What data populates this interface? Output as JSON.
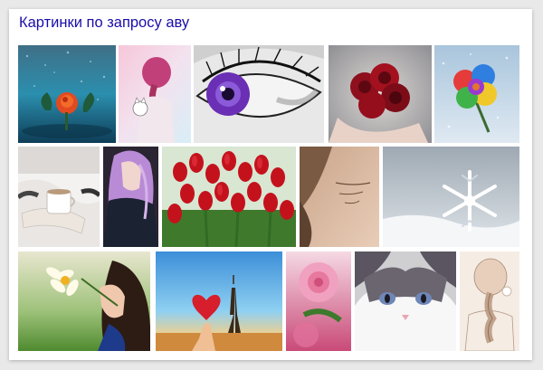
{
  "header": {
    "title": "Картинки по запросу аву"
  },
  "images": [
    {
      "name": "image-rose-in-rain",
      "alt": ""
    },
    {
      "name": "image-girl-braid-cat",
      "alt": ""
    },
    {
      "name": "image-purple-eye",
      "alt": ""
    },
    {
      "name": "image-red-roses-hands",
      "alt": ""
    },
    {
      "name": "image-rainbow-rose",
      "alt": ""
    },
    {
      "name": "image-cozy-cup-legs",
      "alt": ""
    },
    {
      "name": "image-purple-hair-girl",
      "alt": ""
    },
    {
      "name": "image-red-tulips",
      "alt": ""
    },
    {
      "name": "image-girl-tattoo",
      "alt": ""
    },
    {
      "name": "image-snowflake",
      "alt": ""
    },
    {
      "name": "image-daffodil-girl",
      "alt": ""
    },
    {
      "name": "image-heart-eiffel",
      "alt": ""
    },
    {
      "name": "image-pink-roses",
      "alt": ""
    },
    {
      "name": "image-kitten",
      "alt": ""
    },
    {
      "name": "image-braid-sketch",
      "alt": ""
    }
  ],
  "colors": {
    "link": "#1a0dab",
    "background": "#e9e9e9",
    "card": "#ffffff"
  }
}
